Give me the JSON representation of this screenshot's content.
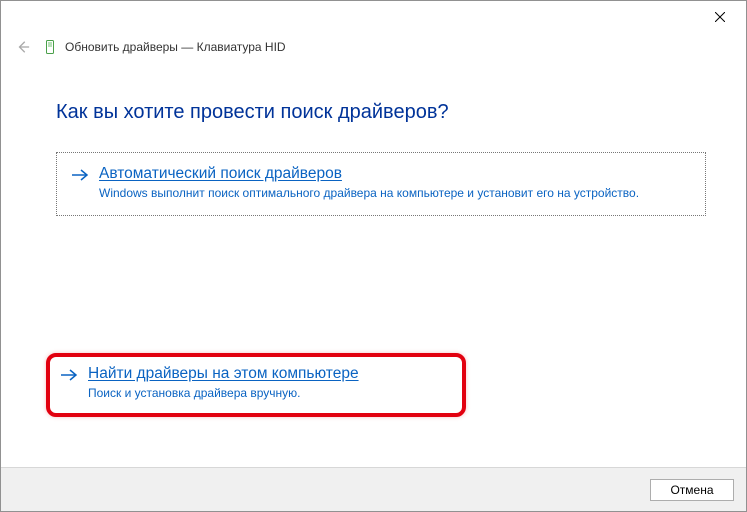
{
  "titlebar": {
    "close_tooltip": "Close"
  },
  "header": {
    "title": "Обновить драйверы — Клавиатура HID"
  },
  "content": {
    "question": "Как вы хотите провести поиск драйверов?",
    "option1": {
      "title": "Автоматический поиск драйверов",
      "desc": "Windows выполнит поиск оптимального драйвера на компьютере и установит его на устройство."
    },
    "option2": {
      "title": "Найти драйверы на этом компьютере",
      "desc": "Поиск и установка драйвера вручную."
    }
  },
  "footer": {
    "cancel": "Отмена"
  }
}
